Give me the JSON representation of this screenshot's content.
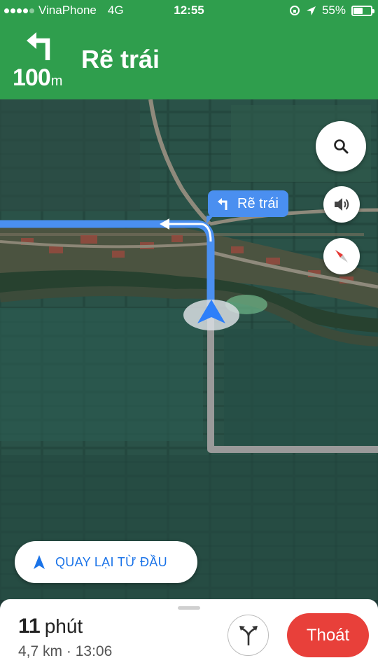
{
  "status_bar": {
    "carrier": "VinaPhone",
    "network": "4G",
    "time": "12:55",
    "battery": "55%",
    "battery_level": 0.55
  },
  "nav_header": {
    "distance_value": "100",
    "distance_unit": "m",
    "instruction": "Rẽ trái",
    "turn_icon": "turn-left-icon",
    "color": "#2f9e4d"
  },
  "map": {
    "turn_callout": "Rẽ trái",
    "route_color": "#4a8ff0",
    "upcoming_route_color": "#9a9a9a"
  },
  "controls": {
    "search_icon": "search-icon",
    "sound_icon": "speaker-icon",
    "compass_icon": "compass-icon",
    "recenter_label": "QUAY LẠI TỪ ĐẦU"
  },
  "bottom_sheet": {
    "duration_value": "11",
    "duration_unit": "phút",
    "distance": "4,7 km",
    "separator": "·",
    "arrival_time": "13:06",
    "exit_label": "Thoát",
    "exit_color": "#e8403a",
    "alt_routes_icon": "alternate-routes-icon"
  }
}
